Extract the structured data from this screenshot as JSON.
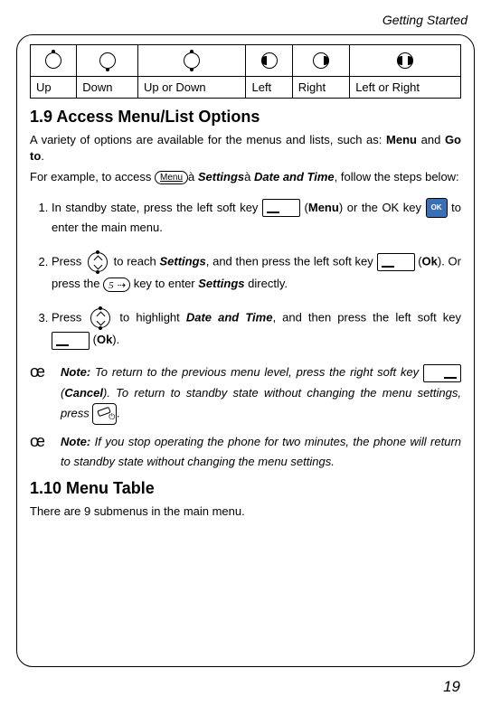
{
  "running_head": "Getting Started",
  "nav_table": {
    "labels": [
      "Up",
      "Down",
      "Up or Down",
      "Left",
      "Right",
      "Left or Right"
    ]
  },
  "section1": {
    "heading": "1.9 Access Menu/List Options",
    "intro_a": "A variety of options are available for the menus and lists, such as: ",
    "intro_b": "Menu",
    "intro_c": " and ",
    "intro_d": "Go to",
    "intro_e": ".",
    "ex_a": "For example, to access ",
    "ex_menu": "Menu",
    "ex_arrow1": "à",
    "ex_settings": "Settings",
    "ex_arrow2": "à",
    "ex_dt": "Date and Time",
    "ex_tail": ", follow the steps below:",
    "s1_a": "In standby state, press the left soft key ",
    "s1_b": " (",
    "s1_c": "Menu",
    "s1_d": ") or the OK key ",
    "s1_e": " to enter the main menu.",
    "s2_a": "Press ",
    "s2_b": " to reach ",
    "s2_c": "Settings",
    "s2_d": ", and then press the left soft key ",
    "s2_e": " (",
    "s2_f": "Ok",
    "s2_g": "). Or press the ",
    "s2_h": " key to enter ",
    "s2_i": "Settings",
    "s2_j": " directly.",
    "s3_a": "Press ",
    "s3_b": " to highlight ",
    "s3_c": "Date and Time",
    "s3_d": ", and then press the left soft key ",
    "s3_e": " (",
    "s3_f": "Ok",
    "s3_g": ")."
  },
  "notes": {
    "marker": "œ",
    "label": "Note:",
    "n1_a": " To return to the previous menu level, press the right soft key ",
    "n1_b": " (",
    "n1_c": "Cancel",
    "n1_d": "). To return to standby state without changing the menu settings, press ",
    "n1_e": ".",
    "n2": " If you stop operating the phone for two minutes, the phone will return to standby state without changing the menu settings."
  },
  "section2": {
    "heading": "1.10 Menu Table",
    "text": "There are 9 submenus in the main menu."
  },
  "page_number": "19"
}
